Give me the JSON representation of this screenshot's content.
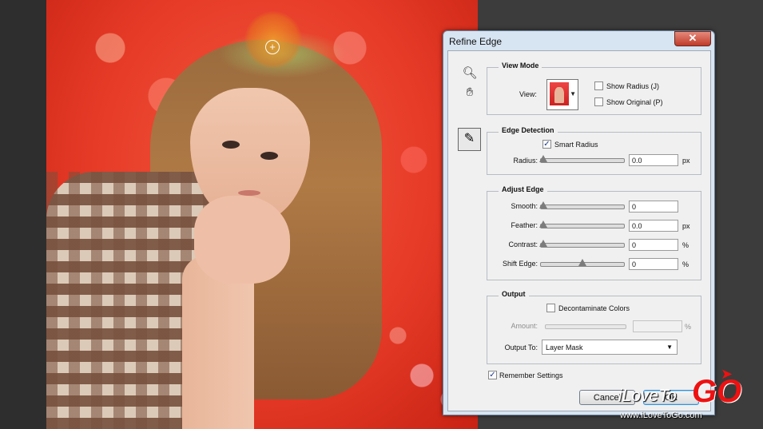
{
  "dialog": {
    "title": "Refine Edge",
    "close_label": "✕",
    "tools": {
      "zoom_icon": "zoom-tool-icon",
      "hand_icon": "hand-tool-icon",
      "refine_brush_icon": "refine-radius-brush-icon"
    },
    "view_mode": {
      "title": "View Mode",
      "view_label": "View:",
      "show_radius": {
        "label": "Show Radius (J)",
        "checked": false
      },
      "show_original": {
        "label": "Show Original (P)",
        "checked": false
      }
    },
    "edge_detection": {
      "title": "Edge Detection",
      "smart_radius": {
        "label": "Smart Radius",
        "checked": true
      },
      "radius": {
        "label": "Radius:",
        "value": "0.0",
        "unit": "px",
        "level": 0
      }
    },
    "adjust_edge": {
      "title": "Adjust Edge",
      "smooth": {
        "label": "Smooth:",
        "value": "0",
        "unit": "",
        "level": 0
      },
      "feather": {
        "label": "Feather:",
        "value": "0.0",
        "unit": "px",
        "level": 0
      },
      "contrast": {
        "label": "Contrast:",
        "value": "0",
        "unit": "%",
        "level": 0
      },
      "shift_edge": {
        "label": "Shift Edge:",
        "value": "0",
        "unit": "%",
        "level": 0.5
      }
    },
    "output": {
      "title": "Output",
      "decontaminate": {
        "label": "Decontaminate Colors",
        "checked": false
      },
      "amount": {
        "label": "Amount:",
        "value": "",
        "unit": "%"
      },
      "output_to_label": "Output To:",
      "output_to_value": "Layer Mask"
    },
    "remember": {
      "label": "Remember Settings",
      "checked": true
    },
    "cancel_label": "Cancel",
    "ok_label": "OK"
  },
  "watermark": {
    "brand": "iLoveTo",
    "brand_go": "GO",
    "url": "www.iLoveToGo.com",
    "accent": "#e11111"
  }
}
